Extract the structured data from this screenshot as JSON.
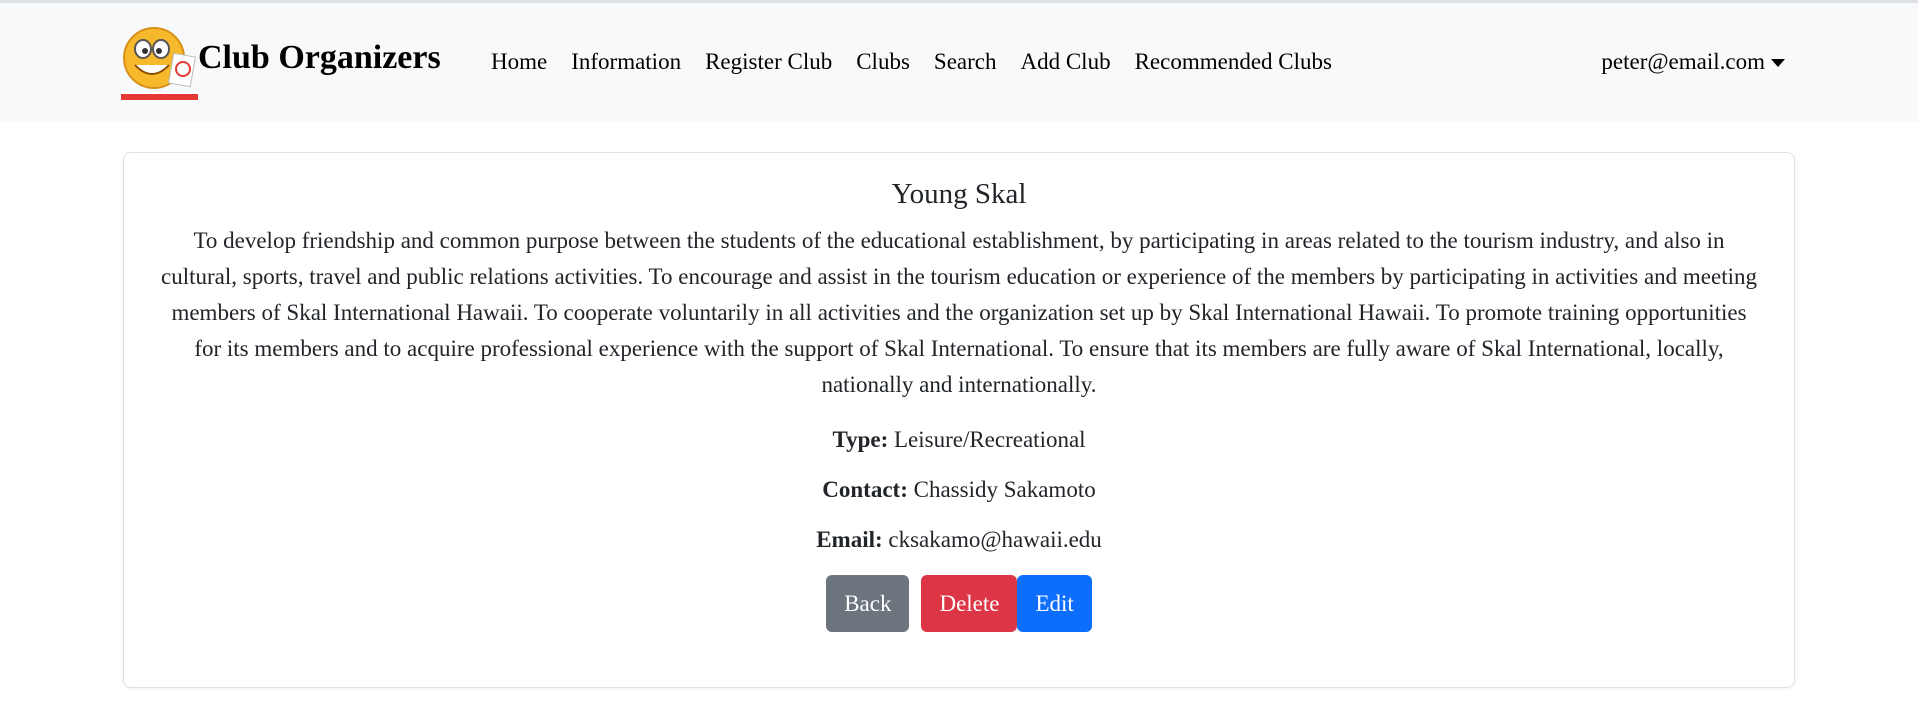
{
  "navbar": {
    "brand": "Club Organizers",
    "logo_icon": "smiley-grade-logo-icon",
    "links": [
      "Home",
      "Information",
      "Register Club",
      "Clubs",
      "Search",
      "Add Club",
      "Recommended Clubs"
    ],
    "user": "peter@email.com"
  },
  "club": {
    "name": "Young Skal",
    "description": "To develop friendship and common purpose between the students of the educational establishment, by participating in areas related to the tourism industry, and also in cultural, sports, travel and public relations activities. To encourage and assist in the tourism education or experience of the members by participating in activities and meeting members of Skal International Hawaii. To cooperate voluntarily in all activities and the organization set up by Skal International Hawaii. To promote training opportunities for its members and to acquire professional experience with the support of Skal International. To ensure that its members are fully aware of Skal International, locally, nationally and internationally.",
    "type_label": "Type:",
    "type": "Leisure/Recreational",
    "contact_label": "Contact:",
    "contact": "Chassidy Sakamoto",
    "email_label": "Email:",
    "email": "cksakamo@hawaii.edu"
  },
  "actions": {
    "back": "Back",
    "delete": "Delete",
    "edit": "Edit"
  },
  "colors": {
    "navbar_bg": "#f8f9fa",
    "back": "#6c757d",
    "delete": "#dc3545",
    "edit": "#0d6efd"
  }
}
